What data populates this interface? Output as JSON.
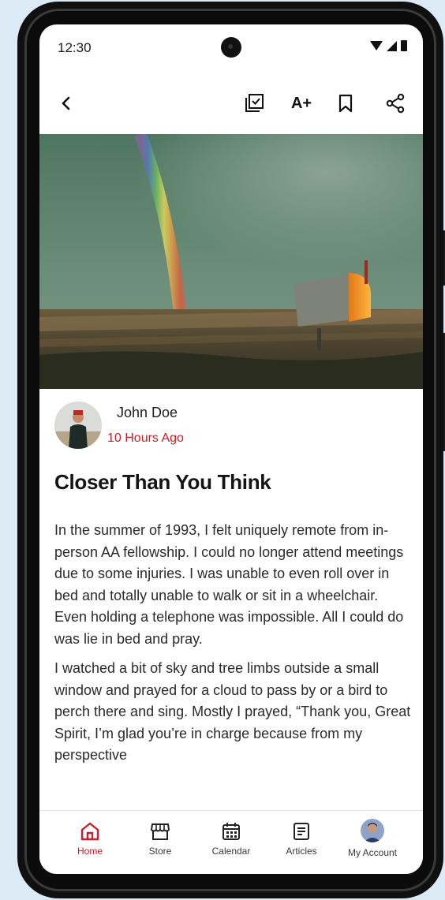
{
  "status_bar": {
    "time": "12:30"
  },
  "toolbar": {
    "back_icon": "chevron-left-icon",
    "checklist_icon": "checklist-icon",
    "font_size_label": "A+",
    "bookmark_icon": "bookmark-icon",
    "share_icon": "share-icon"
  },
  "article": {
    "hero_image": "rainbow over field with mailbox",
    "author": {
      "name": "John Doe",
      "time": "10 Hours Ago"
    },
    "title": "Closer Than You Think",
    "paragraphs": [
      "In the summer of 1993, I felt uniquely remote from in-person AA fellowship. I could no longer attend meetings due to some injuries. I was unable to even roll over in bed and totally unable to walk or sit in a wheelchair. Even holding a telephone was impossible. All I could do was lie in bed and pray.",
      "I watched a bit of sky and tree limbs outside a small window and prayed for a cloud to pass by or a bird to perch there and sing. Mostly I prayed, “Thank you, Great Spirit, I’m glad you’re in charge because from my perspective"
    ]
  },
  "bottom_nav": {
    "items": [
      {
        "label": "Home",
        "icon": "home-icon",
        "active": true
      },
      {
        "label": "Store",
        "icon": "store-icon",
        "active": false
      },
      {
        "label": "Calendar",
        "icon": "calendar-icon",
        "active": false
      },
      {
        "label": "Articles",
        "icon": "articles-icon",
        "active": false
      },
      {
        "label": "My Account",
        "icon": "avatar",
        "active": false
      }
    ]
  },
  "colors": {
    "accent": "#c8202b",
    "page_bg": "#dceaf6"
  }
}
